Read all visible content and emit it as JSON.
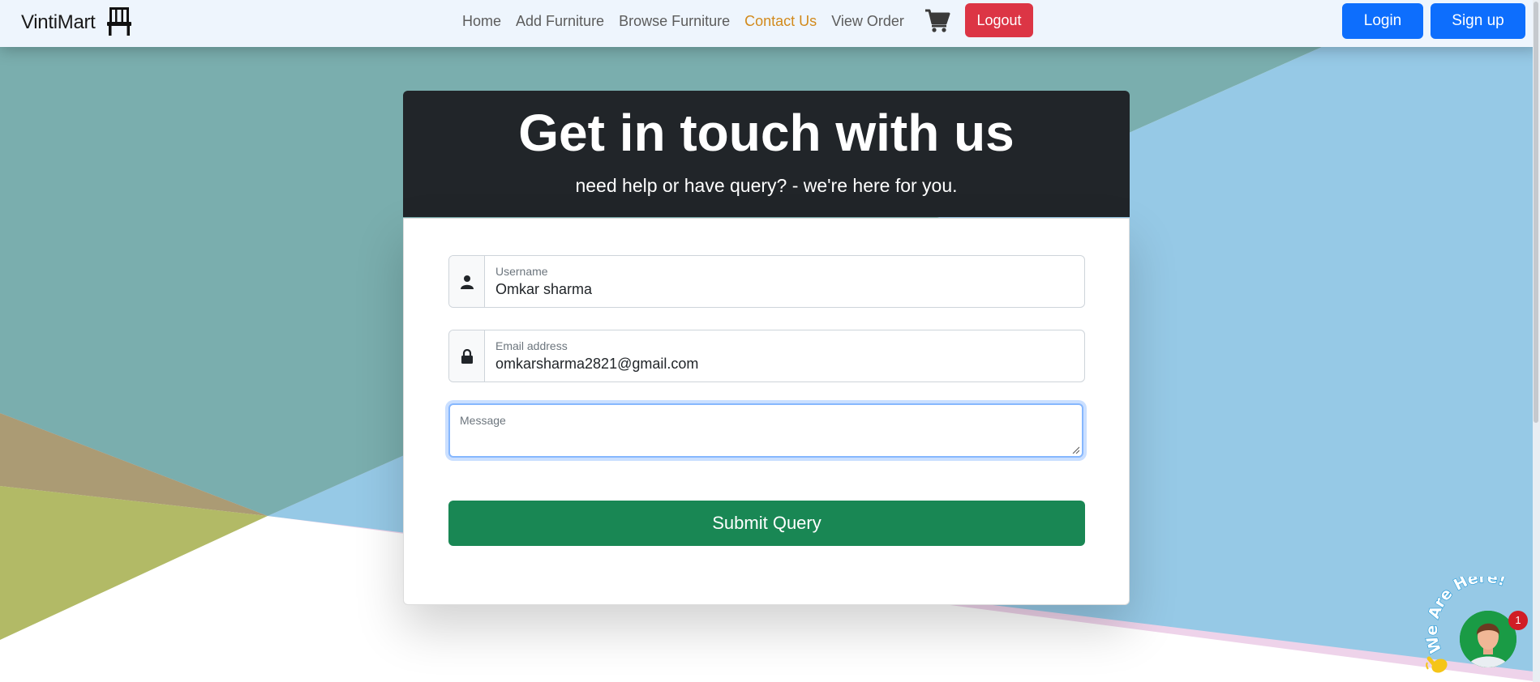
{
  "brand": {
    "name": "VintiMart",
    "icon": "chair-icon"
  },
  "nav": {
    "links": [
      {
        "label": "Home",
        "active": false
      },
      {
        "label": "Add Furniture",
        "active": false
      },
      {
        "label": "Browse Furniture",
        "active": false
      },
      {
        "label": "Contact Us",
        "active": true
      },
      {
        "label": "View Order",
        "active": false
      }
    ],
    "cart_icon": "cart-icon",
    "logout_label": "Logout",
    "login_label": "Login",
    "signup_label": "Sign up"
  },
  "contact": {
    "title": "Get in touch with us",
    "subtitle": "need help or have query? - we're here for you.",
    "username_label": "Username",
    "username_value": "Omkar sharma",
    "username_icon": "person-icon",
    "email_label": "Email address",
    "email_value": "omkarsharma2821@gmail.com",
    "email_icon": "lock-icon",
    "message_label": "Message",
    "submit_label": "Submit Query"
  },
  "chat": {
    "caption": "We Are Here!",
    "badge_count": "1"
  },
  "colors": {
    "accent_active": "#d28a1c",
    "danger": "#dc3545",
    "primary": "#0d6efd",
    "success": "#198754",
    "header_dark": "#212529"
  }
}
